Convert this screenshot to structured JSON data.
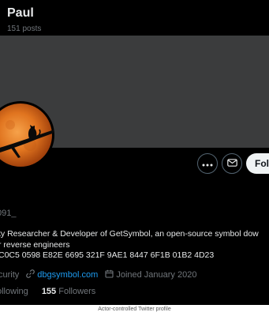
{
  "header": {
    "name": "Paul",
    "posts": "151 posts"
  },
  "actions": {
    "follow_label": "Foll"
  },
  "profile": {
    "handle": "091_",
    "bio": [
      "ty Researcher & Developer of GetSymbol, an open-source symbol dow",
      "r reverse engineers",
      "C0C5 0598 E82E 6695 321F 9AE1 8447 6F1B 01B2 4D23"
    ],
    "location": "curity",
    "website": "dbgsymbol.com",
    "joined": "Joined January 2020",
    "following_label": "ollowing",
    "followers_count": "155",
    "followers_label": "Followers"
  },
  "caption": "Actor-controlled Twitter profile",
  "colors": {
    "background": "#000000",
    "banner": "#3b3c3d",
    "link": "#1d9bf0",
    "muted": "#71767b",
    "text": "#e7e9ea"
  },
  "icons": [
    "more-icon",
    "mail-icon",
    "link-icon",
    "calendar-icon"
  ]
}
